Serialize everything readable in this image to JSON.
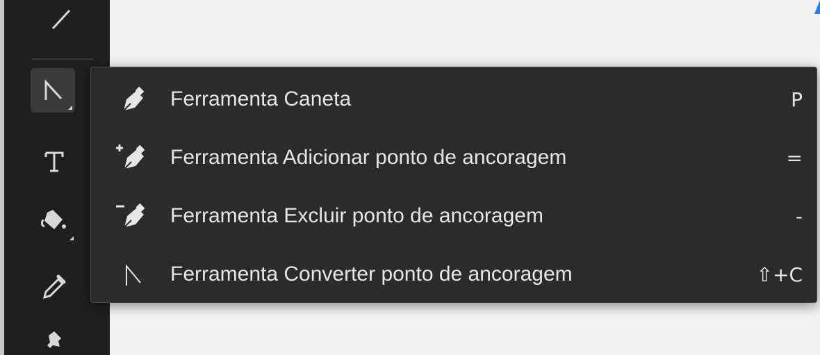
{
  "toolbar": {
    "tools": [
      {
        "name": "line-tool",
        "icon": "line-icon"
      },
      {
        "name": "pen-tool",
        "icon": "pen-corner-icon",
        "selected": true
      },
      {
        "name": "type-tool",
        "icon": "type-icon",
        "glyph": "T"
      },
      {
        "name": "paint-bucket-tool",
        "icon": "paint-bucket-icon"
      },
      {
        "name": "eyedropper-tool",
        "icon": "eyedropper-icon"
      },
      {
        "name": "pin-tool",
        "icon": "pin-icon"
      }
    ]
  },
  "flyout_menu": {
    "items": [
      {
        "label": "Ferramenta Caneta",
        "shortcut": "P",
        "icon": "pen-icon"
      },
      {
        "label": "Ferramenta Adicionar ponto de ancoragem",
        "shortcut": "=",
        "icon": "add-anchor-point-icon"
      },
      {
        "label": "Ferramenta Excluir ponto de ancoragem",
        "shortcut": "-",
        "icon": "delete-anchor-point-icon"
      },
      {
        "label": "Ferramenta Converter ponto de ancoragem",
        "shortcut": "⇧+C",
        "icon": "convert-anchor-point-icon"
      }
    ]
  },
  "colors": {
    "toolbar_bg": "#1f1f1f",
    "menu_bg": "#2b2b2b",
    "text": "#e6e6e6",
    "accent": "#2680eb"
  }
}
